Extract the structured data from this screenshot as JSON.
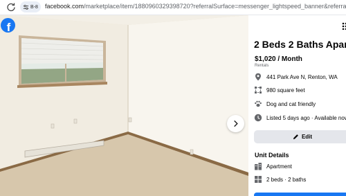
{
  "browser": {
    "site_chip_label": "B-8",
    "url_host": "facebook.com",
    "url_path": "/marketplace/item/1880960329398720?referralSurface=messenger_lightspeed_banner&referralCode=messeng..."
  },
  "viewer": {
    "logo_letter": "f"
  },
  "listing": {
    "title": "2 Beds 2 Baths Apartment",
    "price": "$1,020 / Month",
    "category": "Rentals",
    "details": [
      {
        "icon": "location-pin-icon",
        "text": "441 Park Ave N, Renton, WA"
      },
      {
        "icon": "square-footage-icon",
        "text": "980 square feet"
      },
      {
        "icon": "paw-icon",
        "text": "Dog and cat friendly"
      },
      {
        "icon": "clock-icon",
        "text": "Listed 5 days ago · Available now"
      }
    ],
    "edit_label": "Edit",
    "unit_details_heading": "Unit Details",
    "unit_details": [
      {
        "icon": "building-icon",
        "text": "Apartment"
      },
      {
        "icon": "rooms-icon",
        "text": "2 beds · 2 baths"
      }
    ]
  },
  "colors": {
    "brand_blue": "#1877f2",
    "button_gray": "#e4e6eb",
    "secondary_text": "#65676b"
  }
}
